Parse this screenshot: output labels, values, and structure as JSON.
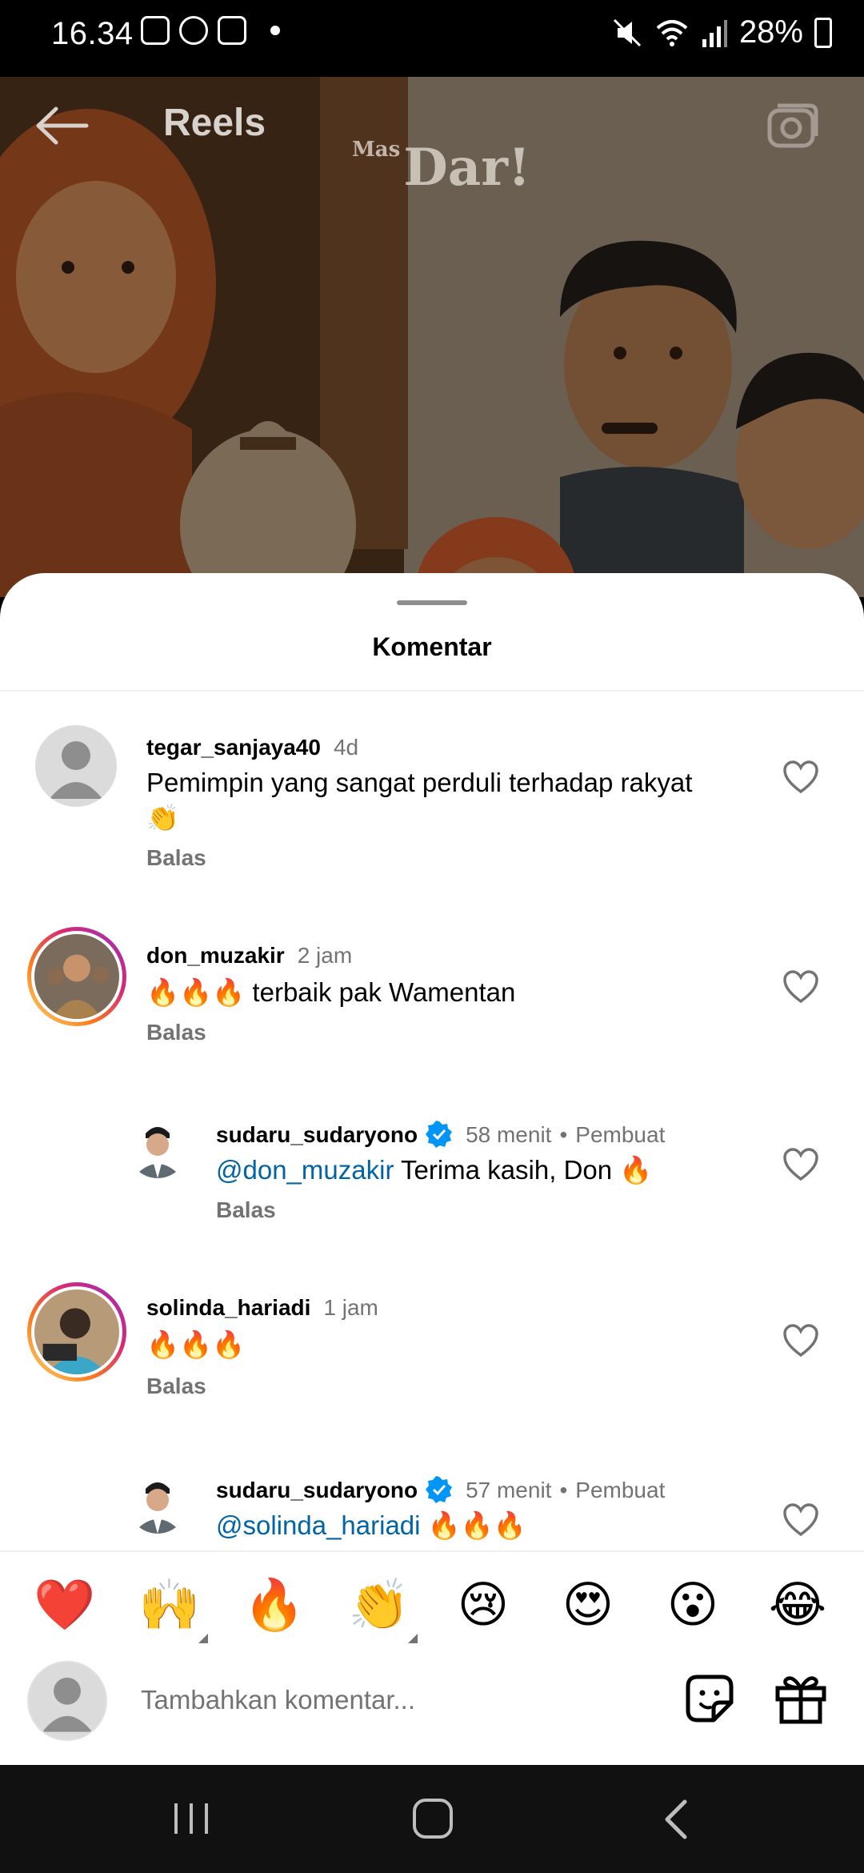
{
  "status_bar": {
    "time": "16.34",
    "battery": "28%",
    "icons_left": [
      "gallery-icon",
      "whatsapp-icon",
      "instagram-icon"
    ],
    "icons_right": [
      "mute-icon",
      "wifi-icon",
      "signal-icon",
      "battery-icon"
    ]
  },
  "header": {
    "title": "Reels",
    "watermark_small": "Mas",
    "watermark_large": "Dar!"
  },
  "sheet": {
    "title": "Komentar"
  },
  "comments": [
    {
      "username": "tegar_sanjaya40",
      "time": "4d",
      "text": "Pemimpin yang sangat perduli terhadap rakyat",
      "text_line2": "👏",
      "reply": "Balas"
    },
    {
      "username": "don_muzakir",
      "time": "2 jam",
      "text": "🔥🔥🔥 terbaik pak Wamentan",
      "reply": "Balas"
    },
    {
      "username": "sudaru_sudaryono",
      "time": "58 menit",
      "creator": "Pembuat",
      "mention": "@don_muzakir",
      "text": " Terima kasih, Don 🔥",
      "reply": "Balas"
    },
    {
      "username": "solinda_hariadi",
      "time": "1 jam",
      "text": "🔥🔥🔥",
      "reply": "Balas"
    },
    {
      "username": "sudaru_sudaryono",
      "time": "57 menit",
      "creator": "Pembuat",
      "mention": "@solinda_hariadi",
      "text": " 🔥🔥🔥"
    }
  ],
  "emoji_bar": [
    "❤️",
    "🙌",
    "🔥",
    "👏",
    "😢",
    "😍",
    "😮",
    "😂"
  ],
  "input": {
    "placeholder": "Tambahkan komentar..."
  },
  "colors": {
    "mention": "#0064a6",
    "secondary_text": "#737373",
    "verified": "#0095f6"
  }
}
